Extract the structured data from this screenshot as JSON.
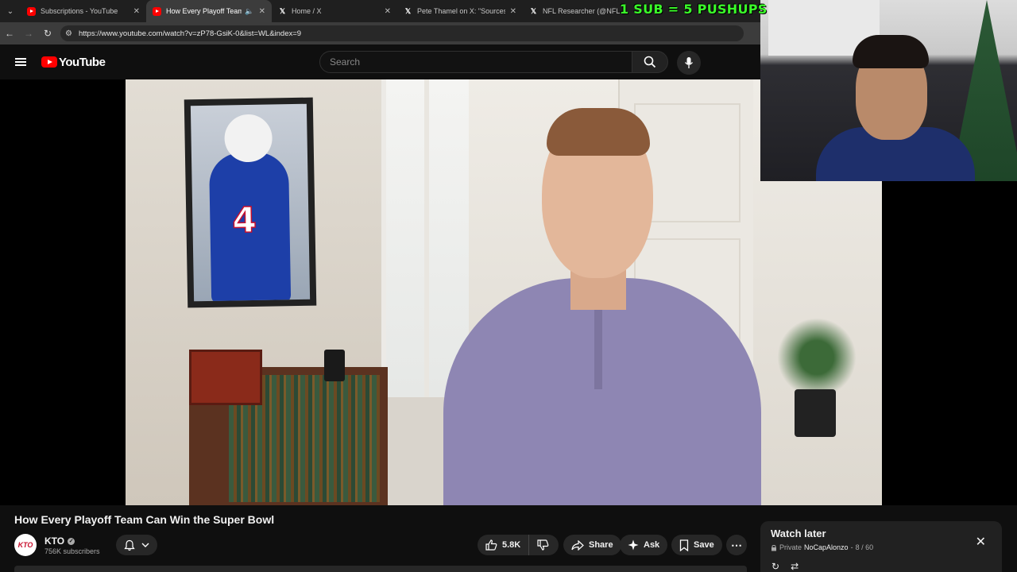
{
  "browser": {
    "tabs": [
      {
        "title": "Subscriptions - YouTube",
        "favicon": "youtube-icon",
        "active": false
      },
      {
        "title": "How Every Playoff Team Ca",
        "favicon": "youtube-icon",
        "active": true
      },
      {
        "title": "Home / X",
        "favicon": "x-icon",
        "active": false
      },
      {
        "title": "Pete Thamel on X: \"Sources: Oh",
        "favicon": "x-icon",
        "active": false
      },
      {
        "title": "NFL Researcher (@NFL_Rese",
        "favicon": "x-icon",
        "active": false
      }
    ],
    "url": "https://www.youtube.com/watch?v=zP78-GsiK-0&list=WL&index=9"
  },
  "stream_overlay": {
    "text": "1 SUB = 5 PUSHUPS",
    "color": "#3bff2a"
  },
  "youtube": {
    "logo_text": "YouTube",
    "search_placeholder": "Search",
    "brand_color": "#ff0000"
  },
  "video": {
    "title": "How Every Playoff Team Can Win the Super Bowl",
    "channel": {
      "name": "KTO",
      "avatar_text": "KTO",
      "subscribers": "756K subscribers"
    },
    "jersey_number": "4",
    "actions": {
      "likes": "5.8K",
      "share": "Share",
      "ask": "Ask",
      "save": "Save"
    }
  },
  "playlist": {
    "title": "Watch later",
    "privacy": "Private",
    "owner": "NoCapAlonzo",
    "position": "8 / 60"
  }
}
